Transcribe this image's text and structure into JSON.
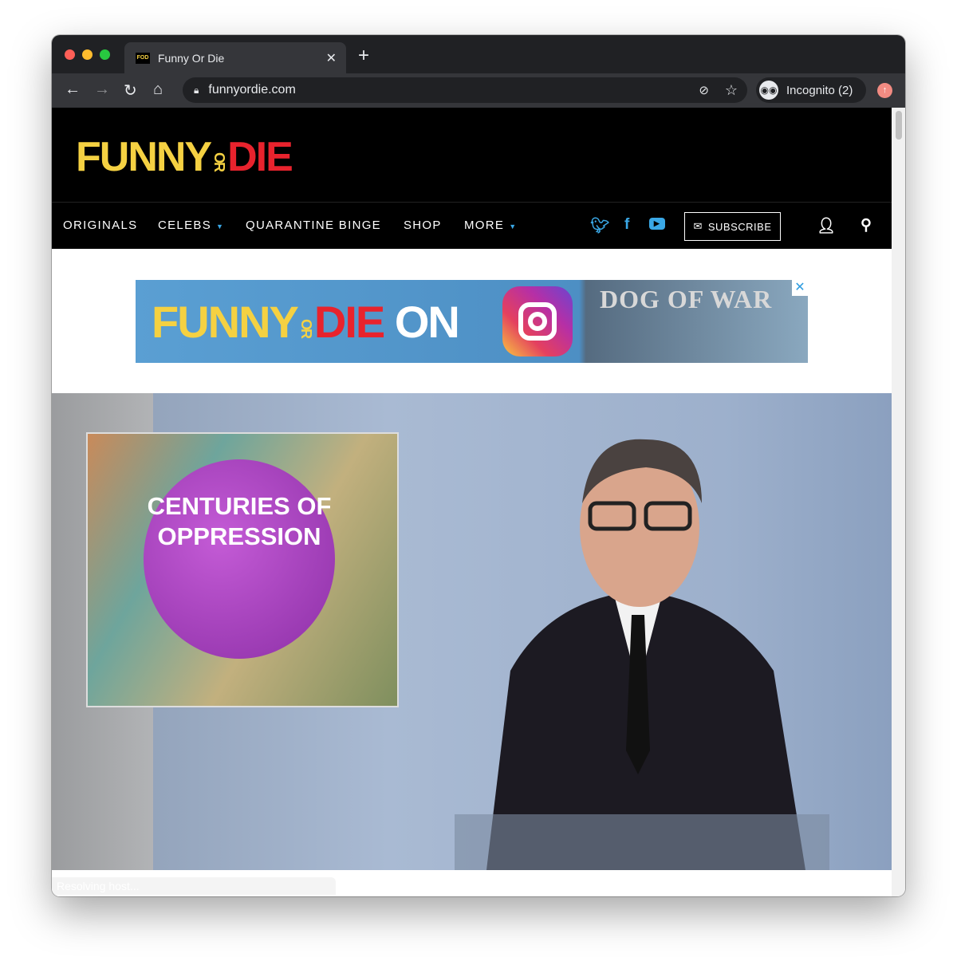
{
  "browser": {
    "tab_title": "Funny Or Die",
    "favicon_text": "FOD",
    "url": "funnyordie.com",
    "profile": "Incognito (2)"
  },
  "site": {
    "logo": {
      "funny": "FUNNY",
      "or": "OR",
      "die": "DIE"
    },
    "nav": [
      {
        "label": "ORIGINALS"
      },
      {
        "label": "CELEBS",
        "dropdown": true
      },
      {
        "label": "QUARANTINE BINGE"
      },
      {
        "label": "SHOP"
      },
      {
        "label": "MORE",
        "dropdown": true
      }
    ],
    "subscribe_label": "SUBSCRIBE",
    "accent": "#3aa8e6",
    "logo_yellow": "#f5d142",
    "logo_red": "#e8232d"
  },
  "ad": {
    "text_funny": "FUNNY",
    "text_or": "OR",
    "text_die": "DIE",
    "text_on": "ON",
    "game_title": "DOG OF WAR"
  },
  "video": {
    "inset_text": "CENTURIES OF OPPRESSION"
  },
  "status_text": "Resolving host..."
}
